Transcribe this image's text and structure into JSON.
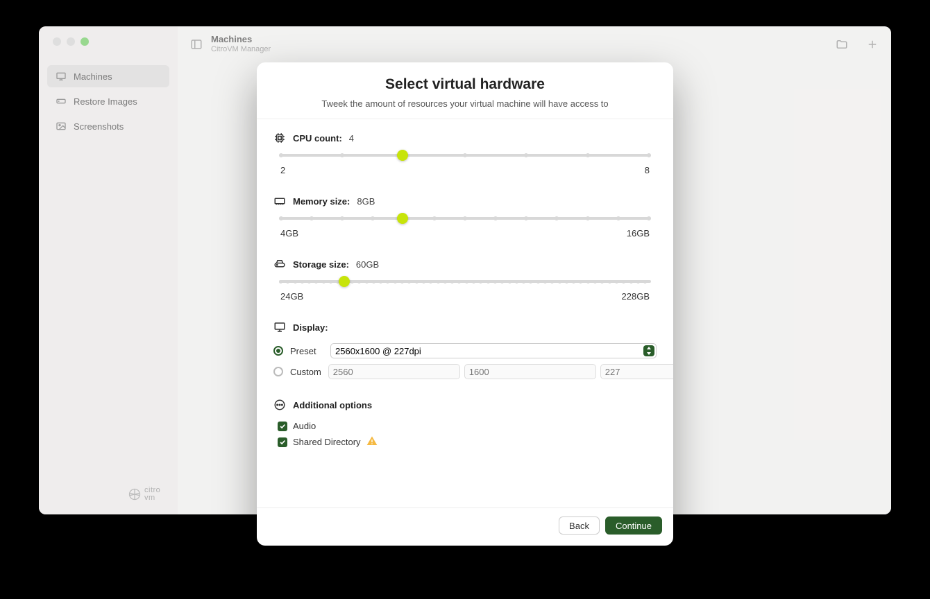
{
  "window": {
    "title": "Machines",
    "subtitle": "CitroVM Manager"
  },
  "sidebar": {
    "items": [
      {
        "label": "Machines"
      },
      {
        "label": "Restore Images"
      },
      {
        "label": "Screenshots"
      }
    ],
    "logo": "citro\nvm"
  },
  "modal": {
    "title": "Select virtual hardware",
    "subtitle": "Tweek the amount of resources your virtual machine will have access to",
    "cpu": {
      "label": "CPU count:",
      "value": "4",
      "min": "2",
      "max": "8"
    },
    "memory": {
      "label": "Memory size:",
      "value": "8GB",
      "min": "4GB",
      "max": "16GB"
    },
    "storage": {
      "label": "Storage size:",
      "value": "60GB",
      "min": "24GB",
      "max": "228GB"
    },
    "display": {
      "label": "Display:",
      "preset_label": "Preset",
      "preset_value": "2560x1600 @ 227dpi",
      "custom_label": "Custom",
      "custom_width_placeholder": "2560",
      "custom_height_placeholder": "1600",
      "custom_dpi_placeholder": "227"
    },
    "additional": {
      "label": "Additional options",
      "audio": "Audio",
      "shared_dir": "Shared Directory"
    },
    "buttons": {
      "back": "Back",
      "continue": "Continue"
    }
  }
}
